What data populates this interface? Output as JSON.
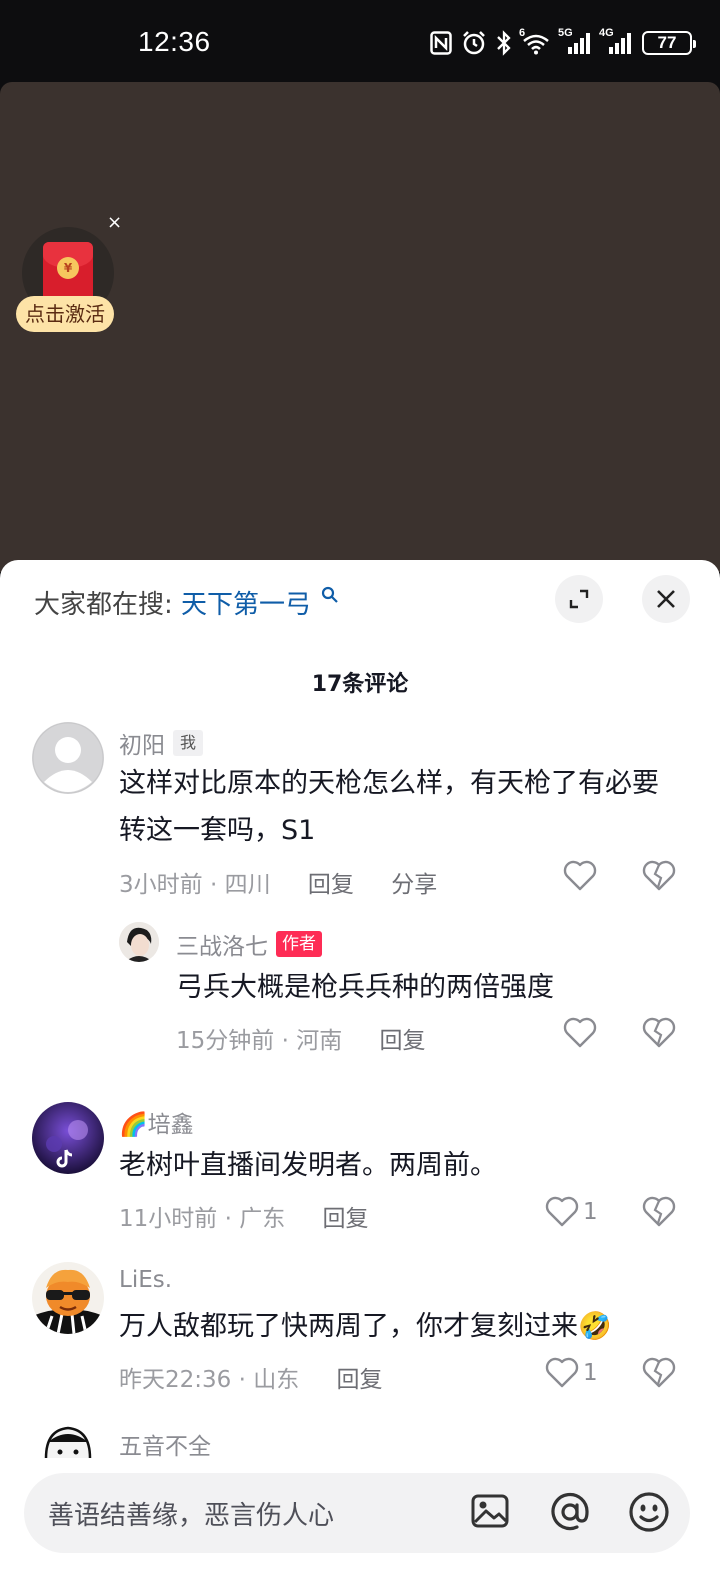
{
  "status": {
    "time": "12:36",
    "battery": "77",
    "net1": "5G",
    "net2": "4G",
    "wifi_badge": "6"
  },
  "redpacket": {
    "coin": "¥",
    "label": "点击激活",
    "close": "×"
  },
  "sheet": {
    "search_prefix": "大家都在搜:",
    "search_term": "天下第一弓",
    "comment_count": "17条评论"
  },
  "comments": [
    {
      "name": "初阳",
      "tag": "我",
      "text": "这样对比原本的天枪怎么样，有天枪了有必要转这一套吗，S1",
      "time": "3小时前",
      "location": "四川",
      "reply_label": "回复",
      "share_label": "分享",
      "likes": ""
    },
    {
      "name": "三战洛七",
      "tag": "作者",
      "text": "弓兵大概是枪兵兵种的两倍强度",
      "time": "15分钟前",
      "location": "河南",
      "reply_label": "回复",
      "likes": ""
    },
    {
      "name": "🌈培鑫",
      "text": "老树叶直播间发明者。两周前。",
      "time": "11小时前",
      "location": "广东",
      "reply_label": "回复",
      "likes": "1"
    },
    {
      "name": "LiEs.",
      "text": "万人敌都玩了快两周了，你才复刻过来🤣",
      "time": "昨天22:36",
      "location": "山东",
      "reply_label": "回复",
      "likes": "1"
    },
    {
      "name": "五音不全"
    }
  ],
  "input": {
    "placeholder": "善语结善缘，恶言伤人心"
  },
  "icons": {
    "search": "search-icon",
    "expand": "expand-icon",
    "close": "close-icon",
    "like": "heart-icon",
    "dislike": "broken-heart-icon",
    "image": "image-icon",
    "mention": "at-icon",
    "emoji": "emoji-icon"
  }
}
